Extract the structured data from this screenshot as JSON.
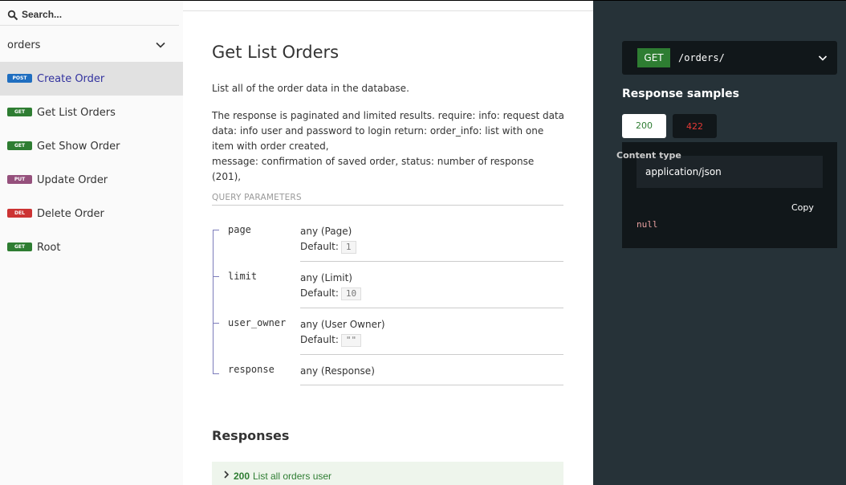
{
  "sidebar": {
    "search_placeholder": "Search...",
    "group_label": "orders",
    "items": [
      {
        "method": "POST",
        "label": "Create Order"
      },
      {
        "method": "GET",
        "label": "Get List Orders"
      },
      {
        "method": "GET",
        "label": "Get Show Order"
      },
      {
        "method": "PUT",
        "label": "Update Order"
      },
      {
        "method": "DEL",
        "label": "Delete Order"
      },
      {
        "method": "GET",
        "label": "Root"
      }
    ]
  },
  "main": {
    "title": "Get List Orders",
    "description_1": "List all of the order data in the database.",
    "description_2": "The response is paginated and limited results. require: info: request data data: info user and password to login return: order_info: list with one item with order created,",
    "description_3": "message: confirmation of saved order, status: number of response (201),",
    "query_params_title": "QUERY PARAMETERS",
    "default_label": "Default:",
    "params": [
      {
        "name": "page",
        "type": "any (Page)",
        "default": "1"
      },
      {
        "name": "limit",
        "type": "any (Limit)",
        "default": "10"
      },
      {
        "name": "user_owner",
        "type": "any (User Owner)",
        "default": "\"\""
      },
      {
        "name": "response",
        "type": "any (Response)"
      }
    ],
    "responses_title": "Responses",
    "response": {
      "code": "200",
      "label": "List all orders user"
    }
  },
  "right": {
    "method": "GET",
    "path": "/orders/",
    "samples_title": "Response samples",
    "tabs": [
      "200",
      "422"
    ],
    "content_type_label": "Content type",
    "content_type_value": "application/json",
    "copy_label": "Copy",
    "sample_value": "null"
  },
  "colors": {
    "get": "#2e7d32",
    "post": "#1f6ec0",
    "put": "#95507c",
    "del": "#cc3333",
    "right_panel": "#263238"
  }
}
